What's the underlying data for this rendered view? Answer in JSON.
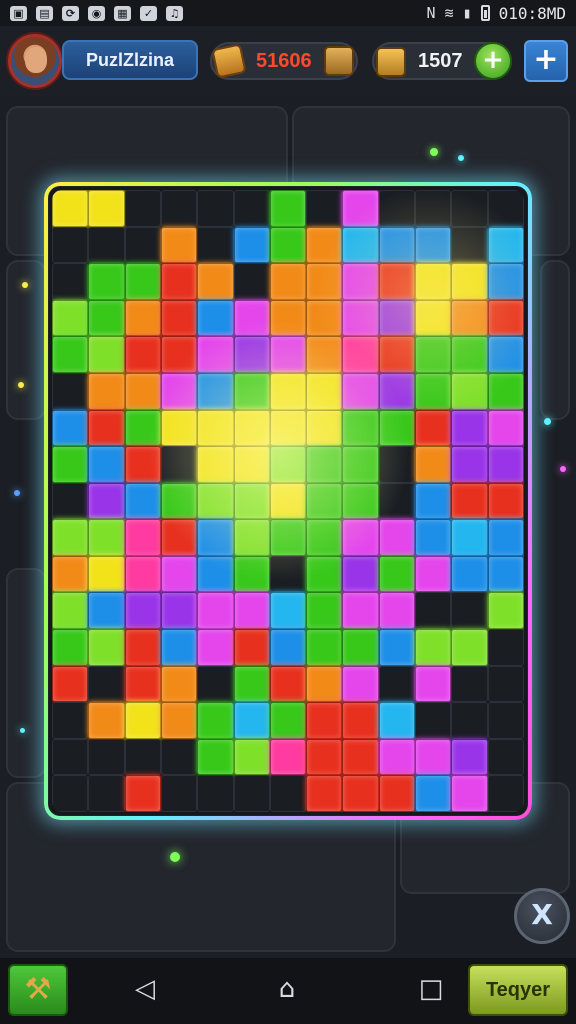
{
  "status_bar": {
    "left_icons": [
      "notification-icon",
      "photo-icon",
      "sync-icon",
      "app-icon",
      "grid-icon",
      "check-icon",
      "music-icon"
    ],
    "time": "010:8MD",
    "right_icons": [
      "nfc-icon",
      "wifi-icon",
      "signal-icon",
      "battery-icon"
    ]
  },
  "header": {
    "player_name": "PuzlZlzina",
    "coins": "51606",
    "gems": "1507",
    "add_gems_label": "+",
    "plus_label": "+"
  },
  "board": {
    "corner_label": "",
    "columns": 13,
    "rows": 17,
    "palette": {
      "G": "#37c81a",
      "L": "#7fe02a",
      "Y": "#f2e21a",
      "O": "#f28a18",
      "R": "#e8301e",
      "P": "#e446ec",
      "V": "#9a34e8",
      "B": "#1e8fe8",
      "C": "#23b6ef",
      "M": "#ff3aa0",
      ".": "#1a1d22"
    },
    "pieces": [
      "YY....G.P....",
      "...O.BGOCBB.C",
      ".GGRO.OOPRYYB",
      "LGORBPOOPVYOR",
      "GLRRPVPOMRGGB",
      ".OOPBGYYPVGLG",
      "BRGYYYYYGGRVP",
      "GBR.YYLGG.OVV",
      ".VBGLLYGG.BRR",
      "LLMRBLGGPPBCB",
      "OYMPBG.GVGPBB",
      "LBVVPPCGPP..L",
      "GLRBPRBGGBLL.",
      "R.RO.GROP.P..",
      ".OYOGCGRRC...",
      "....GLMRRPPV.",
      "..R....RRRBP."
    ]
  },
  "help_button": {
    "icon": "x-icon",
    "label": "X"
  },
  "bottom_bar": {
    "tool_icon": "hammer-icon",
    "nav_back": "◁",
    "nav_home": "⌂",
    "nav_recent": "□",
    "action_label": "Teqyer"
  }
}
